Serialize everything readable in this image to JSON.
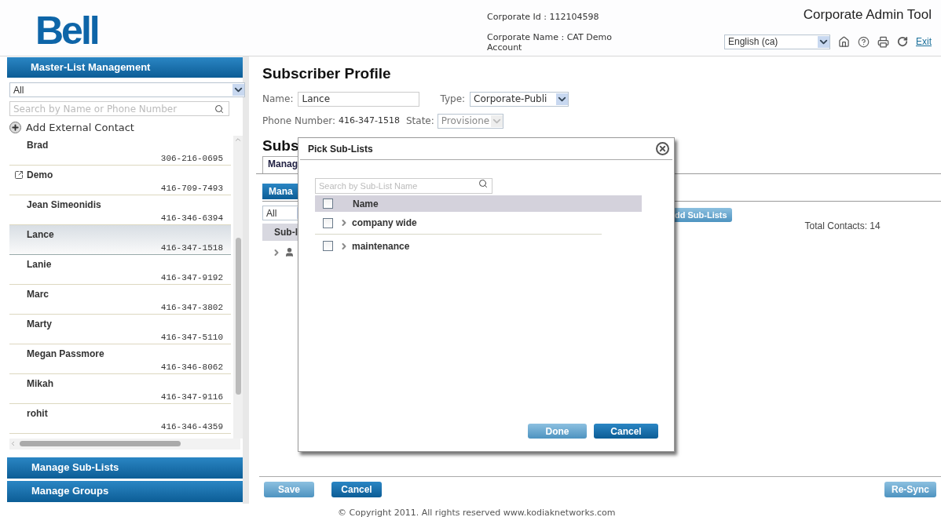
{
  "header": {
    "logo": "Bell",
    "corporate_id": "Corporate Id : 112104598",
    "corporate_name": "Corporate Name : CAT Demo Account",
    "app_title": "Corporate Admin Tool",
    "language": "English (ca)",
    "exit_link": "Exit"
  },
  "sidebar": {
    "title": "Master-List Management",
    "filter": "All",
    "search_placeholder": "Search by Name or Phone Number",
    "add_contact": "Add External Contact",
    "contacts": [
      {
        "name": "Brad",
        "phone": "306-216-0695",
        "external": false,
        "selected": false
      },
      {
        "name": "Demo",
        "phone": "416-709-7493",
        "external": true,
        "selected": false
      },
      {
        "name": "Jean Simeonidis",
        "phone": "416-346-6394",
        "external": false,
        "selected": false
      },
      {
        "name": "Lance",
        "phone": "416-347-1518",
        "external": false,
        "selected": true
      },
      {
        "name": "Lanie",
        "phone": "416-347-9192",
        "external": false,
        "selected": false
      },
      {
        "name": "Marc",
        "phone": "416-347-3802",
        "external": false,
        "selected": false
      },
      {
        "name": "Marty",
        "phone": "416-347-5110",
        "external": false,
        "selected": false
      },
      {
        "name": "Megan Passmore",
        "phone": "416-346-8062",
        "external": false,
        "selected": false
      },
      {
        "name": "Mikah",
        "phone": "416-347-9116",
        "external": false,
        "selected": false
      },
      {
        "name": "rohit",
        "phone": "416-346-4359",
        "external": false,
        "selected": false
      }
    ],
    "sections": [
      "Manage Sub-Lists",
      "Manage Groups"
    ]
  },
  "profile": {
    "title": "Subscriber Profile",
    "name_label": "Name:",
    "name_value": "Lance",
    "type_label": "Type:",
    "type_value": "Corporate-Publi",
    "phone_label": "Phone Number:",
    "phone_value": "416-347-1518",
    "state_label": "State:",
    "state_value": "Provisione"
  },
  "sublists": {
    "title": "Subs",
    "tab": "Manag",
    "manage_button": "Mana",
    "filter": "All",
    "add_button": "dd Sub-Lists",
    "total": "Total Contacts: 14",
    "column": "Sub-l"
  },
  "dialog": {
    "title": "Pick Sub-Lists",
    "search_placeholder": "Search by Sub-List Name",
    "header": "Name",
    "header_checked": false,
    "items": [
      {
        "name": "company wide",
        "checked": false
      },
      {
        "name": "maintenance",
        "checked": false
      }
    ],
    "done": "Done",
    "cancel": "Cancel"
  },
  "footer_buttons": {
    "save": "Save",
    "cancel": "Cancel",
    "resync": "Re-Sync"
  },
  "copyright": "© Copyright 2011. All rights reserved www.kodiaknetworks.com"
}
